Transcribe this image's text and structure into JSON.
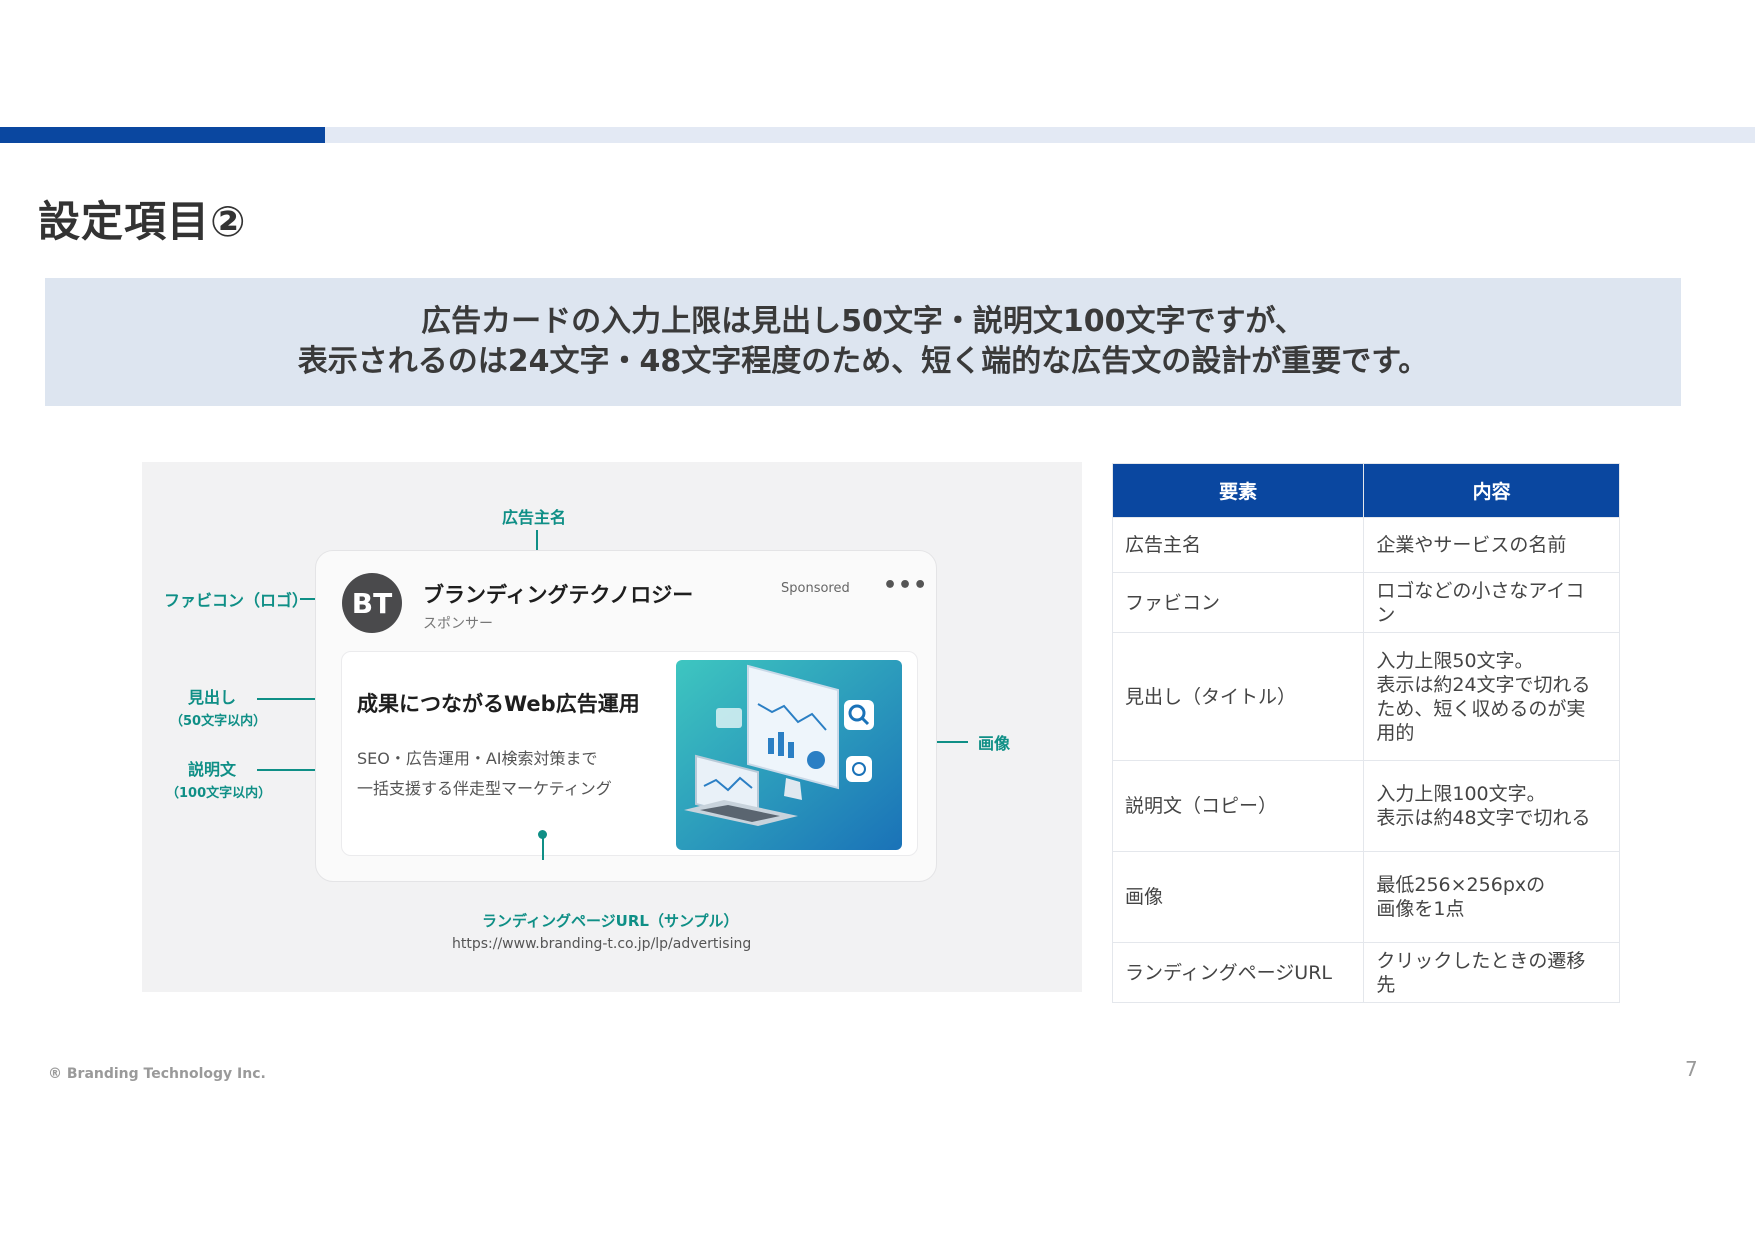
{
  "slide": {
    "title": "設定項目②",
    "page_number": "7",
    "footer": "® Branding Technology Inc.",
    "accent_color": "#0a47a0"
  },
  "callout": {
    "line1": "広告カードの入力上限は見出し50文字・説明文100文字ですが、",
    "line2": "表示されるのは24文字・48文字程度のため、短く端的な広告文の設計が重要です。"
  },
  "figure": {
    "annotations": {
      "advertiser": "広告主名",
      "favicon": "ファビコン（ロゴ）",
      "headline": "見出し",
      "headline_limit": "（50文字以内）",
      "description": "説明文",
      "description_limit": "（100文字以内）",
      "image": "画像",
      "landing_url": "ランディングページURL（サンプル）"
    },
    "ad_card": {
      "avatar_initials": "BT",
      "advertiser_name": "ブランディングテクノロジー",
      "sponsor_label": "スポンサー",
      "sponsored_badge": "Sponsored",
      "menu": "•••",
      "headline": "成果につながるWeb広告運用",
      "description_line1": "SEO・広告運用・AI検索対策まで",
      "description_line2": "一括支援する伴走型マーケティング"
    },
    "url": "https://www.branding-t.co.jp/lp/advertising"
  },
  "table": {
    "headers": [
      "要素",
      "内容"
    ],
    "rows": [
      {
        "element": "広告主名",
        "content": "企業やサービスの名前"
      },
      {
        "element": "ファビコン",
        "content": "ロゴなどの小さなアイコ\nン"
      },
      {
        "element": "見出し（タイトル）",
        "content": "入力上限50文字。\n表示は約24文字で切れる\nため、短く収めるのが実\n用的"
      },
      {
        "element": "説明文（コピー）",
        "content": "入力上限100文字。\n表示は約48文字で切れる"
      },
      {
        "element": "画像",
        "content": "最低256×256pxの\n画像を1点"
      },
      {
        "element": "ランディングページURL",
        "content": "クリックしたときの遷移\n先"
      }
    ]
  }
}
